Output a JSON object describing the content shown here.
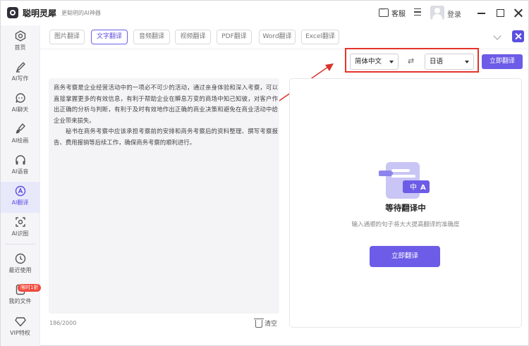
{
  "app": {
    "name": "聪明灵犀",
    "slogan": "更聪明的AI神器",
    "service_label": "客服",
    "login_label": "登录"
  },
  "sidebar": {
    "items": [
      {
        "label": "首页",
        "icon": "home-icon"
      },
      {
        "label": "AI写作",
        "icon": "pen-icon"
      },
      {
        "label": "AI聊天",
        "icon": "chat-icon"
      },
      {
        "label": "AI绘画",
        "icon": "paint-icon"
      },
      {
        "label": "AI语音",
        "icon": "headphone-icon"
      },
      {
        "label": "AI翻译",
        "icon": "translate-icon",
        "active": true
      },
      {
        "label": "AI识图",
        "icon": "scan-icon"
      },
      {
        "label": "最近使用",
        "icon": "clock-icon"
      },
      {
        "label": "我的文件",
        "icon": "file-icon"
      },
      {
        "label": "VIP特权",
        "icon": "diamond-icon"
      }
    ],
    "vip_badge": "限时1折"
  },
  "tabs": [
    {
      "label": "图片翻译"
    },
    {
      "label": "文字翻译",
      "active": true
    },
    {
      "label": "音频翻译"
    },
    {
      "label": "视频翻译"
    },
    {
      "label": "PDF翻译"
    },
    {
      "label": "Word翻译"
    },
    {
      "label": "Excel翻译"
    }
  ],
  "language": {
    "source": "简体中文",
    "target": "日语",
    "swap_symbol": "⇄",
    "translate_label": "立即翻译"
  },
  "source_panel": {
    "paragraph1": "商务考察是企业经营活动中的一项必不可少的活动，通过亲身体验和深入考察，可以直接掌握更多的有效信息，有利于帮助企业在瞬息万变的商场中知己知彼，对客户作出正确的分析与判断，有利于及时有效地作出正确的商业决策和避免在商业活动中给企业带来损失。",
    "paragraph2": "秘书在商务考察中应该承担考察前的安排和商务考察后的资料整理、撰写考察报告、费用报销等后续工作，确保商务考察的顺利进行。",
    "char_count": "186/2000",
    "clear_label": "清空"
  },
  "result_panel": {
    "illustration_zh": "中",
    "illustration_a": "A",
    "title": "等待翻译中",
    "subtitle": "输入通顺的句子将大大提高翻译的准确度",
    "translate_label": "立即翻译"
  },
  "colors": {
    "accent": "#6c5ce7",
    "highlight_box": "#e5332a",
    "sidebar_bg": "#f5f5f8"
  }
}
